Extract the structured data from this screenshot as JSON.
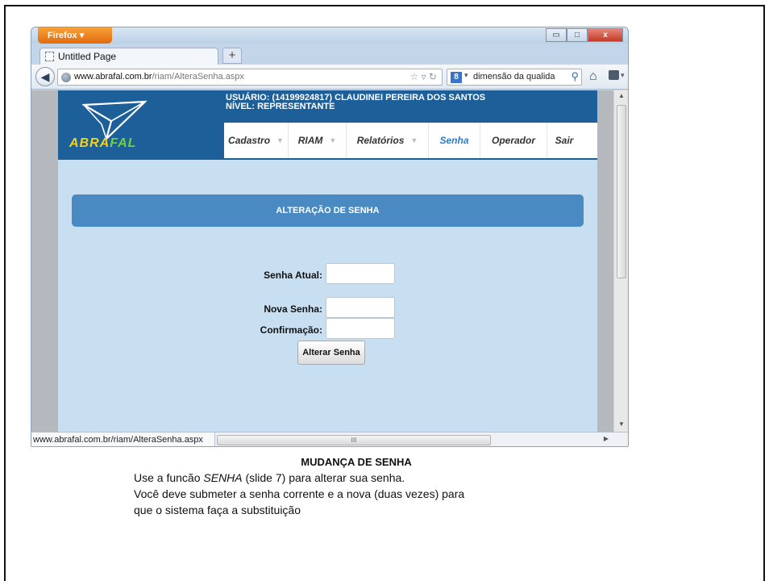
{
  "browser": {
    "app_button": "Firefox",
    "window_buttons": {
      "minimize": "▭",
      "maximize": "□",
      "close": "x"
    },
    "tab_title": "Untitled Page",
    "new_tab": "+",
    "url_domain": "www.abrafal.com.br",
    "url_path": "/riam/AlteraSenha.aspx",
    "search_engine": "8",
    "search_text": "dimensão da qualida",
    "status_url": "www.abrafal.com.br/riam/AlteraSenha.aspx",
    "hscroll_grip": "III"
  },
  "site": {
    "logo_part1": "ABRA",
    "logo_part2": "FAL",
    "user_line": "USUÁRIO: (14199924817) CLAUDINEI PEREIRA DOS SANTOS",
    "level_line": "NÍVEL: REPRESENTANTE",
    "menu": [
      {
        "label": "Cadastro",
        "caret": "▼",
        "active": false
      },
      {
        "label": "RIAM",
        "caret": "▼",
        "active": false
      },
      {
        "label": "Relatórios",
        "caret": "▼",
        "active": false
      },
      {
        "label": "Senha",
        "active": true
      },
      {
        "label": "Operador",
        "active": false
      },
      {
        "label": "Sair",
        "active": false
      }
    ]
  },
  "form": {
    "banner": "ALTERAÇÃO DE SENHA",
    "current_label": "Senha Atual:",
    "new_label": "Nova Senha:",
    "confirm_label": "Confirmação:",
    "current_value": "",
    "new_value": "",
    "confirm_value": "",
    "submit_label": "Alterar Senha"
  },
  "caption": {
    "title": "MUDANÇA DE SENHA",
    "line1_prefix": "Use a funcão ",
    "line1_emph": "SENHA",
    "line1_suffix": "  (slide 7) para alterar sua senha.",
    "line2": "Você deve submeter a senha corrente e a nova (duas vezes) para",
    "line3": "que o sistema faça a substituição"
  },
  "colors": {
    "header_blue": "#1c5f99",
    "banner_blue": "#4a8ac2",
    "page_bg": "#c8dff2",
    "active_menu": "#2e7bc6"
  }
}
